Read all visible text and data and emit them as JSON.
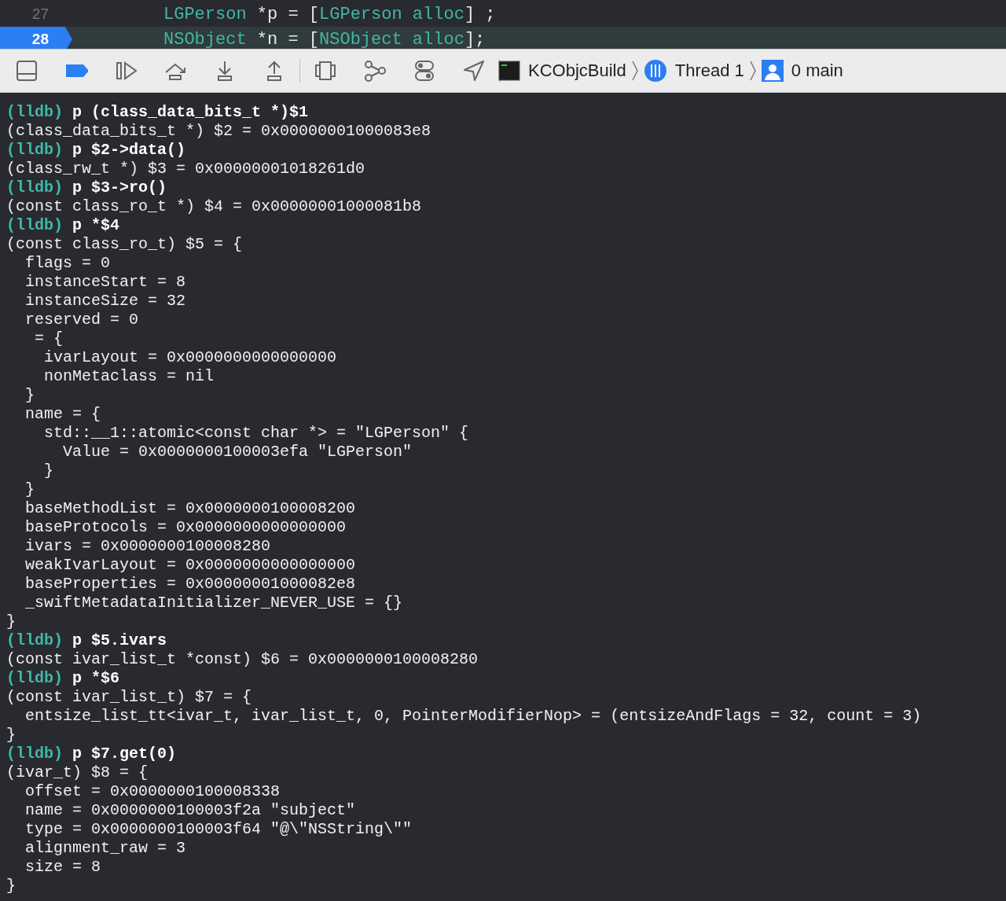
{
  "editor": {
    "lines": [
      {
        "number": "27",
        "current": false,
        "tokens": [
          {
            "kind": "type",
            "text": "LGPerson"
          },
          {
            "kind": "plain",
            "text": " *p = ["
          },
          {
            "kind": "type",
            "text": "LGPerson"
          },
          {
            "kind": "method",
            "text": " alloc"
          },
          {
            "kind": "plain",
            "text": "] ;"
          }
        ]
      },
      {
        "number": "28",
        "current": true,
        "tokens": [
          {
            "kind": "type",
            "text": "NSObject"
          },
          {
            "kind": "plain",
            "text": " *n = ["
          },
          {
            "kind": "type",
            "text": "NSObject"
          },
          {
            "kind": "method",
            "text": " alloc"
          },
          {
            "kind": "plain",
            "text": "];"
          }
        ]
      }
    ]
  },
  "debug_bar": {
    "buttons": [
      {
        "kind": "toggle-console",
        "active": false
      },
      {
        "kind": "breakpoints",
        "active": true
      },
      {
        "kind": "continue",
        "active": false
      },
      {
        "kind": "step-over",
        "active": false
      },
      {
        "kind": "step-into",
        "active": false
      },
      {
        "kind": "step-out",
        "active": false
      },
      {
        "kind": "divider"
      },
      {
        "kind": "view-hierarchy",
        "active": false
      },
      {
        "kind": "memory-graph",
        "active": false
      },
      {
        "kind": "environment",
        "active": false
      },
      {
        "kind": "location",
        "active": false
      },
      {
        "kind": "divider"
      }
    ],
    "breadcrumb": [
      {
        "kind": "target",
        "label": "KCObjcBuild"
      },
      {
        "kind": "thread",
        "label": "Thread 1"
      },
      {
        "kind": "frame",
        "label": "0 main"
      }
    ]
  },
  "console": {
    "lines": [
      {
        "kind": "prompt",
        "prompt": "(lldb)",
        "text": "p (class_data_bits_t *)$1"
      },
      {
        "kind": "output",
        "text": "(class_data_bits_t *) $2 = 0x00000001000083e8"
      },
      {
        "kind": "prompt",
        "prompt": "(lldb)",
        "text": "p $2->data()"
      },
      {
        "kind": "output",
        "text": "(class_rw_t *) $3 = 0x00000001018261d0"
      },
      {
        "kind": "prompt",
        "prompt": "(lldb)",
        "text": "p $3->ro()"
      },
      {
        "kind": "output",
        "text": "(const class_ro_t *) $4 = 0x00000001000081b8"
      },
      {
        "kind": "prompt",
        "prompt": "(lldb)",
        "text": "p *$4"
      },
      {
        "kind": "output",
        "text": "(const class_ro_t) $5 = {"
      },
      {
        "kind": "output",
        "text": "  flags = 0"
      },
      {
        "kind": "output",
        "text": "  instanceStart = 8"
      },
      {
        "kind": "output",
        "text": "  instanceSize = 32"
      },
      {
        "kind": "output",
        "text": "  reserved = 0"
      },
      {
        "kind": "output",
        "text": "   = {"
      },
      {
        "kind": "output",
        "text": "    ivarLayout = 0x0000000000000000"
      },
      {
        "kind": "output",
        "text": "    nonMetaclass = nil"
      },
      {
        "kind": "output",
        "text": "  }"
      },
      {
        "kind": "output",
        "text": "  name = {"
      },
      {
        "kind": "output",
        "text": "    std::__1::atomic<const char *> = \"LGPerson\" {"
      },
      {
        "kind": "output",
        "text": "      Value = 0x0000000100003efa \"LGPerson\""
      },
      {
        "kind": "output",
        "text": "    }"
      },
      {
        "kind": "output",
        "text": "  }"
      },
      {
        "kind": "output",
        "text": "  baseMethodList = 0x0000000100008200"
      },
      {
        "kind": "output",
        "text": "  baseProtocols = 0x0000000000000000"
      },
      {
        "kind": "output",
        "text": "  ivars = 0x0000000100008280"
      },
      {
        "kind": "output",
        "text": "  weakIvarLayout = 0x0000000000000000"
      },
      {
        "kind": "output",
        "text": "  baseProperties = 0x00000001000082e8"
      },
      {
        "kind": "output",
        "text": "  _swiftMetadataInitializer_NEVER_USE = {}"
      },
      {
        "kind": "output",
        "text": "}"
      },
      {
        "kind": "prompt",
        "prompt": "(lldb)",
        "text": "p $5.ivars"
      },
      {
        "kind": "output",
        "text": "(const ivar_list_t *const) $6 = 0x0000000100008280"
      },
      {
        "kind": "prompt",
        "prompt": "(lldb)",
        "text": "p *$6"
      },
      {
        "kind": "output",
        "text": "(const ivar_list_t) $7 = {"
      },
      {
        "kind": "output",
        "text": "  entsize_list_tt<ivar_t, ivar_list_t, 0, PointerModifierNop> = (entsizeAndFlags = 32, count = 3)"
      },
      {
        "kind": "output",
        "text": "}"
      },
      {
        "kind": "prompt",
        "prompt": "(lldb)",
        "text": "p $7.get(0)"
      },
      {
        "kind": "output",
        "text": "(ivar_t) $8 = {"
      },
      {
        "kind": "output",
        "text": "  offset = 0x0000000100008338"
      },
      {
        "kind": "output",
        "text": "  name = 0x0000000100003f2a \"subject\""
      },
      {
        "kind": "output",
        "text": "  type = 0x0000000100003f64 \"@\\\"NSString\\\"\""
      },
      {
        "kind": "output",
        "text": "  alignment_raw = 3"
      },
      {
        "kind": "output",
        "text": "  size = 8"
      },
      {
        "kind": "output",
        "text": "}"
      }
    ]
  }
}
